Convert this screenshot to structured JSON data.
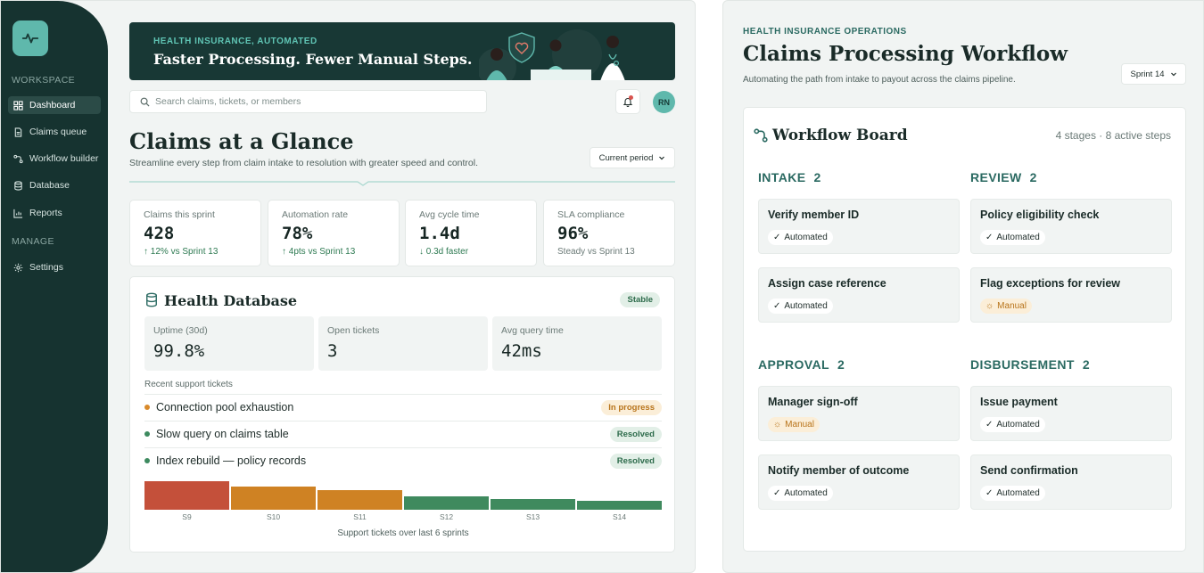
{
  "sidebar": {
    "sections": [
      {
        "label": "WORKSPACE"
      },
      {
        "label": "MANAGE"
      }
    ],
    "items": [
      {
        "label": "Dashboard",
        "icon": "grid-icon",
        "active": true
      },
      {
        "label": "Claims queue",
        "icon": "file-icon"
      },
      {
        "label": "Workflow builder",
        "icon": "workflow-icon"
      },
      {
        "label": "Database",
        "icon": "database-icon"
      },
      {
        "label": "Reports",
        "icon": "chart-icon"
      },
      {
        "label": "Settings",
        "icon": "gear-icon"
      }
    ]
  },
  "banner": {
    "kicker": "HEALTH INSURANCE, AUTOMATED",
    "title": "Faster Processing. Fewer Manual Steps."
  },
  "search": {
    "placeholder": "Search claims, tickets, or members"
  },
  "user": {
    "initials": "RN"
  },
  "header": {
    "title": "Claims at a Glance",
    "subtitle": "Streamline every step from claim intake to resolution with greater speed and control.",
    "period": "Current period"
  },
  "kpis": [
    {
      "label": "Claims this sprint",
      "value": "428",
      "delta": "↑ 12% vs Sprint 13",
      "tone": "good"
    },
    {
      "label": "Automation rate",
      "value": "78%",
      "delta": "↑ 4pts vs Sprint 13",
      "tone": "good"
    },
    {
      "label": "Avg cycle time",
      "value": "1.4d",
      "delta": "↓ 0.3d faster",
      "tone": "good"
    },
    {
      "label": "SLA compliance",
      "value": "96%",
      "delta": "Steady vs Sprint 13",
      "tone": "neutral"
    }
  ],
  "database": {
    "title": "Health Database",
    "status": "Stable",
    "stats": [
      {
        "label": "Uptime (30d)",
        "value": "99.8%"
      },
      {
        "label": "Open tickets",
        "value": "3"
      },
      {
        "label": "Avg query time",
        "value": "42ms"
      }
    ],
    "recent_label": "Recent support tickets",
    "tickets": [
      {
        "text": "Connection pool exhaustion",
        "status": "In progress",
        "color": "#d98a2b"
      },
      {
        "text": "Slow query on claims table",
        "status": "Resolved",
        "color": "#3d8a5f"
      },
      {
        "text": "Index rebuild — policy records",
        "status": "Resolved",
        "color": "#3d8a5f"
      }
    ],
    "chart_caption": "Support tickets over last 6 sprints"
  },
  "chart_data": {
    "type": "bar",
    "categories": [
      "S9",
      "S10",
      "S11",
      "S12",
      "S13",
      "S14"
    ],
    "values": [
      32,
      26,
      22,
      15,
      12,
      10
    ],
    "colors": [
      "#c4503a",
      "#cf8223",
      "#cf8223",
      "#3f8a5e",
      "#3f8a5e",
      "#3f8a5e"
    ],
    "title": "Support tickets over last 6 sprints",
    "ylim": [
      0,
      34
    ]
  },
  "workflow": {
    "kicker": "HEALTH INSURANCE OPERATIONS",
    "title": "Claims Processing Workflow",
    "subtitle": "Automating the path from intake to payout across the claims pipeline.",
    "sprint": "Sprint 14",
    "board_title": "Workflow Board",
    "board_meta": "4 stages · 8 active steps",
    "stages": [
      {
        "name": "INTAKE",
        "count": "2",
        "steps": [
          {
            "title": "Verify member ID",
            "mode": "Automated"
          },
          {
            "title": "Assign case reference",
            "mode": "Automated"
          }
        ]
      },
      {
        "name": "REVIEW",
        "count": "2",
        "steps": [
          {
            "title": "Policy eligibility check",
            "mode": "Automated"
          },
          {
            "title": "Flag exceptions for review",
            "mode": "Manual"
          }
        ]
      },
      {
        "name": "APPROVAL",
        "count": "2",
        "steps": [
          {
            "title": "Manager sign-off",
            "mode": "Manual"
          },
          {
            "title": "Notify member of outcome",
            "mode": "Automated"
          }
        ]
      },
      {
        "name": "DISBURSEMENT",
        "count": "2",
        "steps": [
          {
            "title": "Issue payment",
            "mode": "Automated"
          },
          {
            "title": "Send confirmation",
            "mode": "Automated"
          }
        ]
      }
    ]
  }
}
